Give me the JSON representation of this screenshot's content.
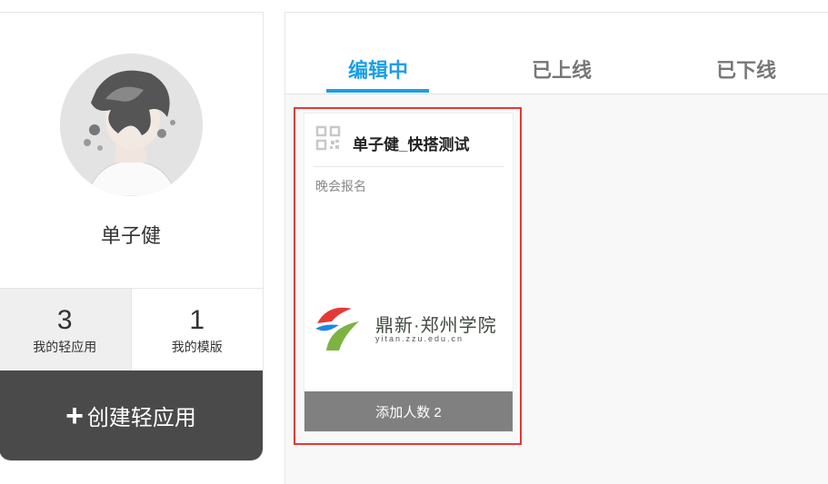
{
  "profile": {
    "username": "单子健",
    "stats": [
      {
        "number": "3",
        "label": "我的轻应用"
      },
      {
        "number": "1",
        "label": "我的模版"
      }
    ],
    "create_button": {
      "icon": "plus-icon",
      "label": "创建轻应用"
    }
  },
  "tabs": [
    {
      "label": "编辑中",
      "active": true
    },
    {
      "label": "已上线",
      "active": false
    },
    {
      "label": "已下线",
      "active": false
    }
  ],
  "card": {
    "icon": "qrcode-icon",
    "title": "单子健_快搭测试",
    "description": "晚会报名",
    "logo": {
      "name": "鼎新·郑州学院",
      "url": "yitan.zzu.edu.cn"
    },
    "count_button": "添加人数 2"
  },
  "colors": {
    "accent": "#1a9fe6",
    "highlight": "#e53935",
    "dark_button": "#4a4a4a",
    "count_button": "#808080"
  }
}
